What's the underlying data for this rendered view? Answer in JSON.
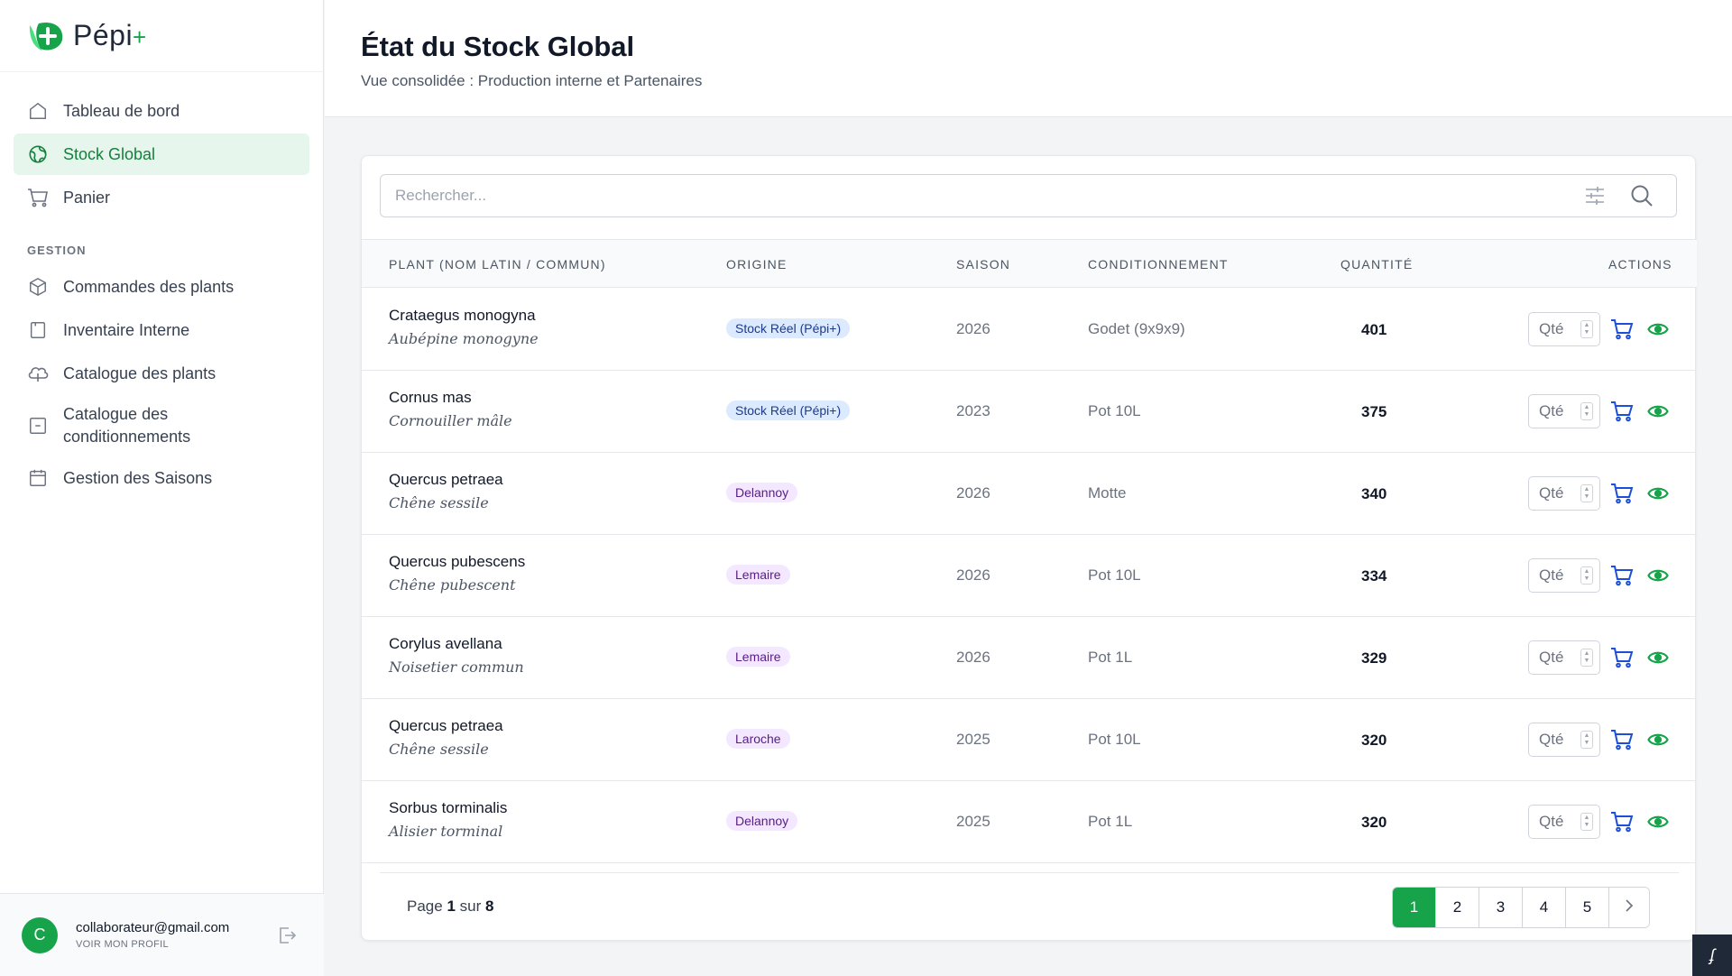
{
  "app": {
    "name": "Pépi",
    "name_suffix": "+"
  },
  "sidebar": {
    "items": [
      {
        "label": "Tableau de bord",
        "icon": "home-icon"
      },
      {
        "label": "Stock Global",
        "icon": "globe-icon",
        "active": true
      },
      {
        "label": "Panier",
        "icon": "cart-icon"
      }
    ],
    "section_label": "GESTION",
    "gestion_items": [
      {
        "label": "Commandes des plants",
        "icon": "box-icon"
      },
      {
        "label": "Inventaire Interne",
        "icon": "clipboard-icon"
      },
      {
        "label": "Catalogue des plants",
        "icon": "cloud-icon"
      },
      {
        "label": "Catalogue des conditionnements",
        "line1": "Catalogue des",
        "line2": "conditionnements",
        "icon": "archive-icon"
      },
      {
        "label": "Gestion des Saisons",
        "icon": "calendar-icon"
      }
    ],
    "user": {
      "initial": "C",
      "email": "collaborateur@gmail.com",
      "profile_link": "VOIR MON PROFIL"
    }
  },
  "header": {
    "title": "État du Stock Global",
    "subtitle": "Vue consolidée : Production interne et Partenaires"
  },
  "search": {
    "placeholder": "Rechercher..."
  },
  "table": {
    "columns": [
      "PLANT (NOM LATIN / COMMUN)",
      "ORIGINE",
      "SAISON",
      "CONDITIONNEMENT",
      "QUANTITÉ",
      "ACTIONS"
    ],
    "qty_placeholder": "Qté",
    "rows": [
      {
        "latin": "Crataegus monogyna",
        "common": "Aubépine monogyne",
        "origin": "Stock Réel (Pépi+)",
        "origin_type": "blue",
        "season": "2026",
        "packaging": "Godet (9x9x9)",
        "quantity": "401"
      },
      {
        "latin": "Cornus mas",
        "common": "Cornouiller mâle",
        "origin": "Stock Réel (Pépi+)",
        "origin_type": "blue",
        "season": "2023",
        "packaging": "Pot 10L",
        "quantity": "375"
      },
      {
        "latin": "Quercus petraea",
        "common": "Chêne sessile",
        "origin": "Delannoy",
        "origin_type": "purple",
        "season": "2026",
        "packaging": "Motte",
        "quantity": "340"
      },
      {
        "latin": "Quercus pubescens",
        "common": "Chêne pubescent",
        "origin": "Lemaire",
        "origin_type": "purple",
        "season": "2026",
        "packaging": "Pot 10L",
        "quantity": "334"
      },
      {
        "latin": "Corylus avellana",
        "common": "Noisetier commun",
        "origin": "Lemaire",
        "origin_type": "purple",
        "season": "2026",
        "packaging": "Pot 1L",
        "quantity": "329"
      },
      {
        "latin": "Quercus petraea",
        "common": "Chêne sessile",
        "origin": "Laroche",
        "origin_type": "purple",
        "season": "2025",
        "packaging": "Pot 10L",
        "quantity": "320"
      },
      {
        "latin": "Sorbus torminalis",
        "common": "Alisier torminal",
        "origin": "Delannoy",
        "origin_type": "purple",
        "season": "2025",
        "packaging": "Pot 1L",
        "quantity": "320"
      }
    ]
  },
  "pagination": {
    "prefix": "Page",
    "current": "1",
    "middle": "sur",
    "total": "8",
    "pages": [
      "1",
      "2",
      "3",
      "4",
      "5"
    ],
    "next_icon": "chevron-right-icon"
  },
  "colors": {
    "accent": "#16a34a",
    "cart": "#1d4ed8",
    "eye": "#16a34a"
  }
}
